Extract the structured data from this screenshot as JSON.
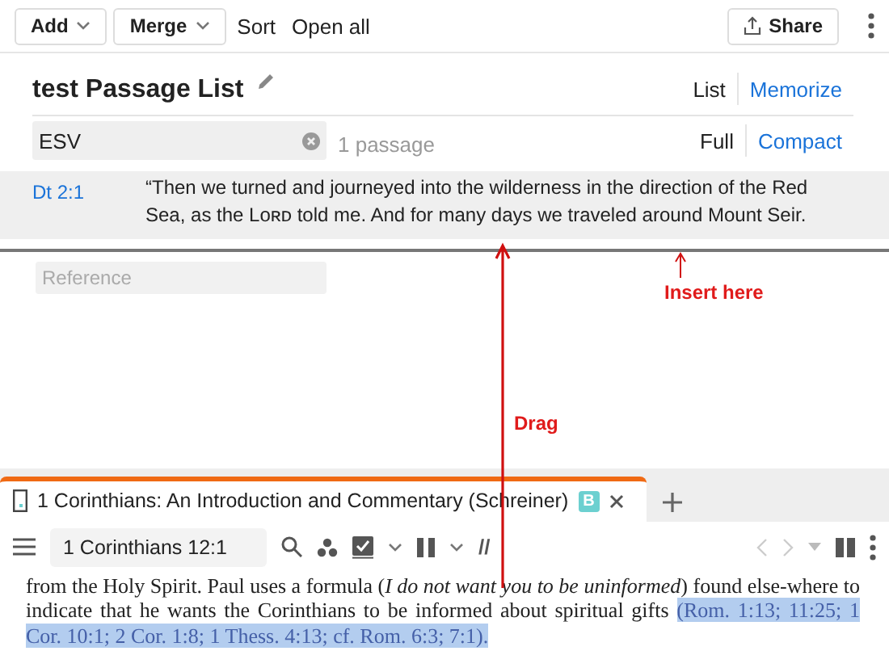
{
  "toolbar": {
    "buttons": [
      {
        "label": "Add",
        "kind": "dropdown"
      },
      {
        "label": "Merge",
        "kind": "dropdown"
      },
      {
        "label": "Sort",
        "kind": "text"
      },
      {
        "label": "Open all",
        "kind": "text"
      }
    ],
    "share": "Share"
  },
  "list": {
    "title": "test Passage List",
    "views": [
      {
        "label": "List",
        "selected": true
      },
      {
        "label": "Memorize",
        "selected": false
      }
    ],
    "version": "ESV",
    "count": "1 passage",
    "densities": [
      {
        "label": "Full",
        "selected": true
      },
      {
        "label": "Compact",
        "selected": false
      }
    ],
    "passages": [
      {
        "reference": "Dt 2:1",
        "text": "“Then we turned and journeyed into the wilderness in the direction of the Red Sea, as the Lᴏʀᴅ told me. And for many days we traveled around Mount Seir."
      }
    ],
    "reference_placeholder": "Reference"
  },
  "annotations": [
    {
      "kind": "drag",
      "label": "Drag"
    },
    {
      "kind": "insert",
      "label": "Insert here"
    }
  ],
  "reader": {
    "tab": {
      "title": "1 Corinthians: An Introduction and Commentary (Schreiner)",
      "badge": "B"
    },
    "reference": "1 Corinthians 12:1",
    "parallel": "//",
    "paragraph": [
      {
        "text": "from the Holy Spirit. Paul uses a formula (*I do not want you to be uninformed*) found else-where to indicate that he wants the Corinthians to be informed about spiritual gifts ",
        "highlighted": false
      },
      {
        "text": "(Rom. 1:13; 11:25; 1 Cor. 10:1; 2 Cor. 1:8; 1 Thess. 4:13; cf. Rom. 6:3; 7:1).",
        "highlighted": true
      }
    ]
  }
}
